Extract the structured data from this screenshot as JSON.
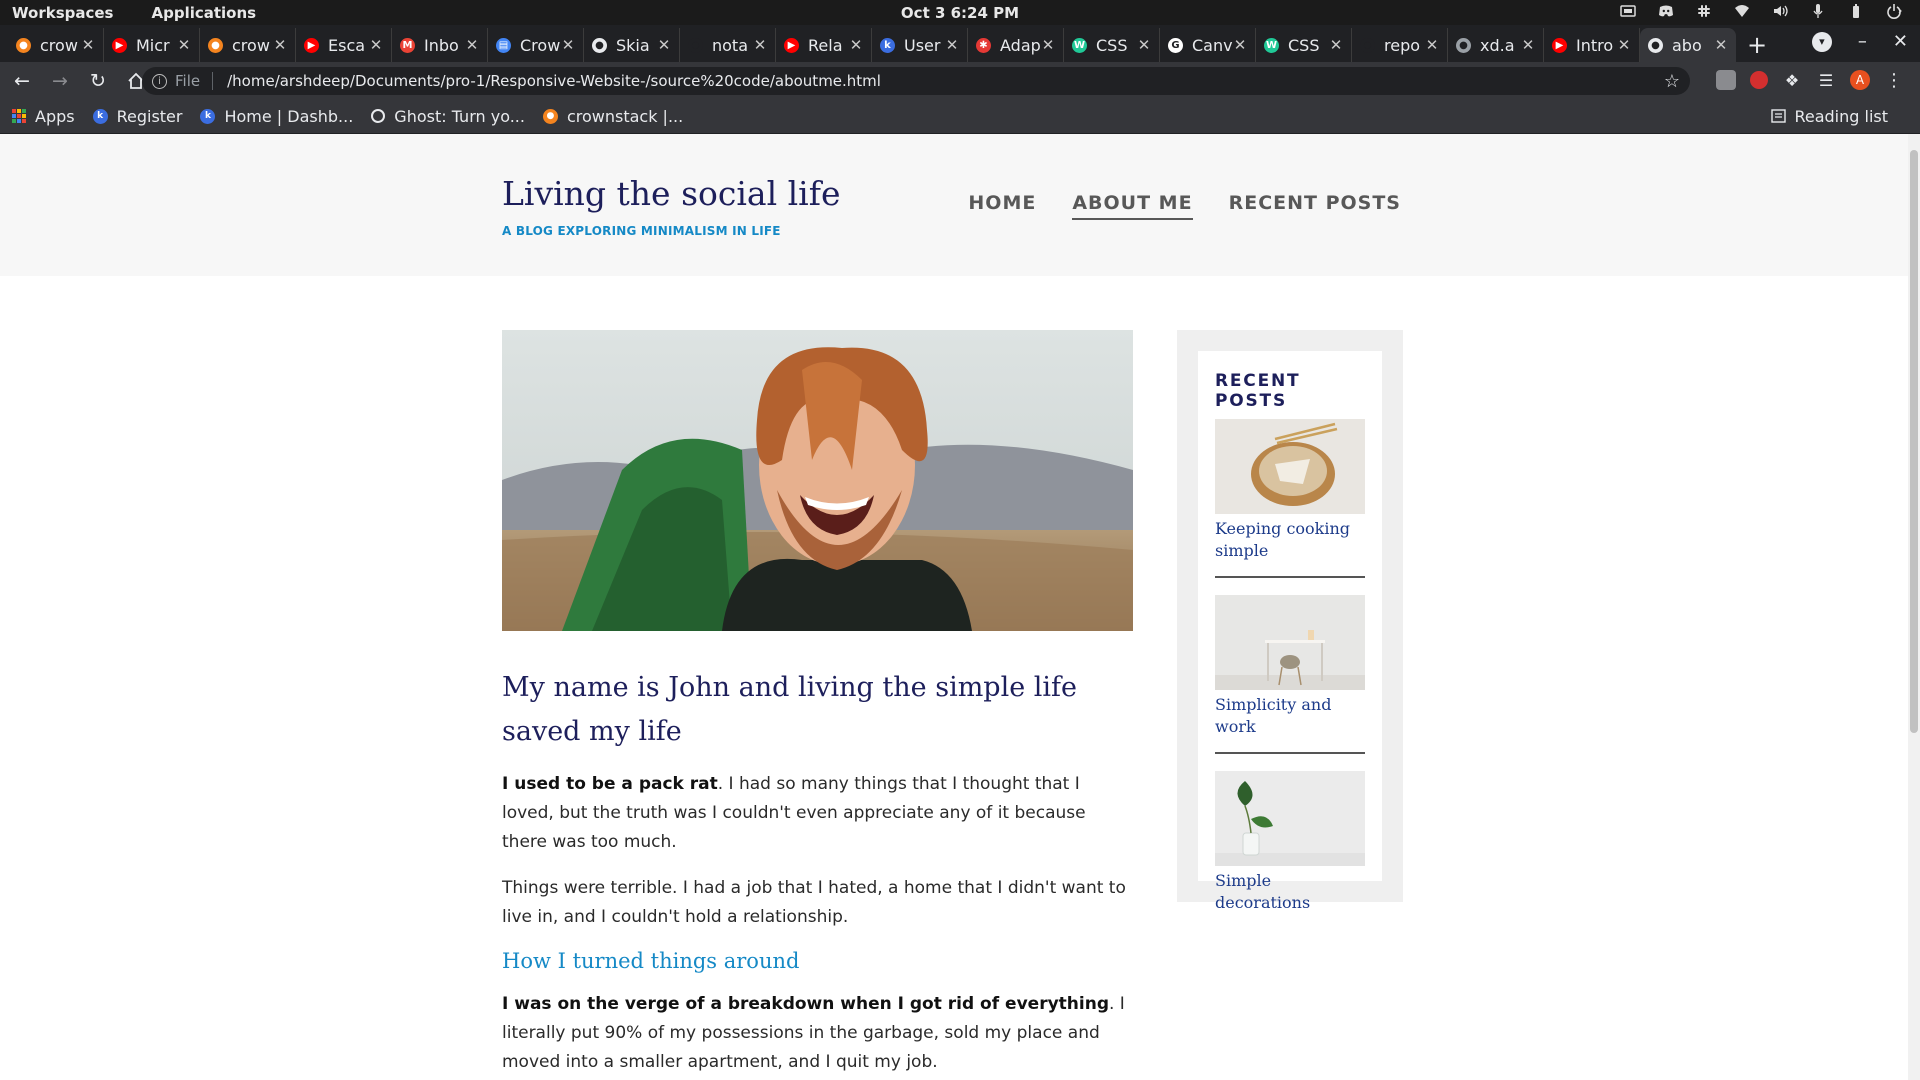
{
  "os": {
    "left_menu": [
      "Workspaces",
      "Applications"
    ],
    "clock": "Oct 3   6:24 PM",
    "tray_icons": [
      "screenshot-icon",
      "discord-icon",
      "slack-icon",
      "wifi-icon",
      "volume-icon",
      "microphone-icon",
      "battery-icon",
      "power-icon"
    ]
  },
  "tabs": [
    {
      "title": "crow",
      "icon": "crowdstrike-icon",
      "color": "#f4841f"
    },
    {
      "title": "Micr",
      "icon": "youtube-icon",
      "color": "#ff0000"
    },
    {
      "title": "crow",
      "icon": "crowdstrike-icon",
      "color": "#f4841f"
    },
    {
      "title": "Esca",
      "icon": "youtube-icon",
      "color": "#ff0000"
    },
    {
      "title": "Inbo",
      "icon": "gmail-icon",
      "color": "#ea4335"
    },
    {
      "title": "Crow",
      "icon": "doc-icon",
      "color": "#4285f4"
    },
    {
      "title": "Skia",
      "icon": "globe-icon",
      "color": "#e8eaed"
    },
    {
      "title": "nota",
      "icon": "github-icon",
      "color": "#202124"
    },
    {
      "title": "Rela",
      "icon": "youtube-icon",
      "color": "#ff0000"
    },
    {
      "title": "User",
      "icon": "k-icon",
      "color": "#3b6de0"
    },
    {
      "title": "Adap",
      "icon": "asterisk-icon",
      "color": "#e53935"
    },
    {
      "title": "CSS",
      "icon": "w-icon",
      "color": "#20c997"
    },
    {
      "title": "Canv",
      "icon": "google-icon",
      "color": "#ffffff"
    },
    {
      "title": "CSS",
      "icon": "w-icon",
      "color": "#20c997"
    },
    {
      "title": "repo",
      "icon": "github-icon",
      "color": "#202124"
    },
    {
      "title": "xd.a",
      "icon": "globe-icon",
      "color": "#9aa0a6"
    },
    {
      "title": "Intro",
      "icon": "youtube-icon",
      "color": "#ff0000"
    },
    {
      "title": "abo",
      "icon": "globe-icon",
      "color": "#e8eaed",
      "active": true
    }
  ],
  "toolbar": {
    "scheme": "File",
    "url": "/home/arshdeep/Documents/pro-1/Responsive-Website-/source%20code/aboutme.html",
    "profile_initial": "A"
  },
  "bookmarks": [
    {
      "label": "Apps",
      "icon": "apps-grid-icon"
    },
    {
      "label": "Register",
      "icon": "k-icon"
    },
    {
      "label": "Home | Dashb...",
      "icon": "k-icon"
    },
    {
      "label": "Ghost: Turn yo...",
      "icon": "ghost-icon"
    },
    {
      "label": "crownstack |...",
      "icon": "crownstack-icon"
    }
  ],
  "reading_list": "Reading list",
  "site": {
    "title": "Living the social life",
    "tagline": "A BLOG EXPLORING MINIMALISM IN LIFE",
    "nav": [
      {
        "label": "HOME"
      },
      {
        "label": "ABOUT ME",
        "current": true
      },
      {
        "label": "RECENT POSTS"
      }
    ]
  },
  "article": {
    "heading": "My name is John and living the simple life saved my life",
    "p1_bold": "I used to be a pack rat",
    "p1_rest": ". I had so many things that I thought that I loved, but the truth was I couldn't even appreciate any of it because there was too much.",
    "p2": "Things were terrible. I had a job that I hated, a home that I didn't want to live in, and I couldn't hold a relationship.",
    "subheading": "How I turned things around",
    "p3_bold": "I was on the verge of a breakdown when I got rid of everything",
    "p3_rest": ". I literally put 90% of my possessions in the garbage, sold my place and moved into a smaller apartment, and I quit my job."
  },
  "sidebar": {
    "title": "RECENT POSTS",
    "posts": [
      {
        "caption": "Keeping cooking simple",
        "image": "food-bowl-image"
      },
      {
        "caption": "Simplicity and work",
        "image": "desk-chair-image"
      },
      {
        "caption": "Simple decorations",
        "image": "plant-vase-image"
      }
    ]
  }
}
